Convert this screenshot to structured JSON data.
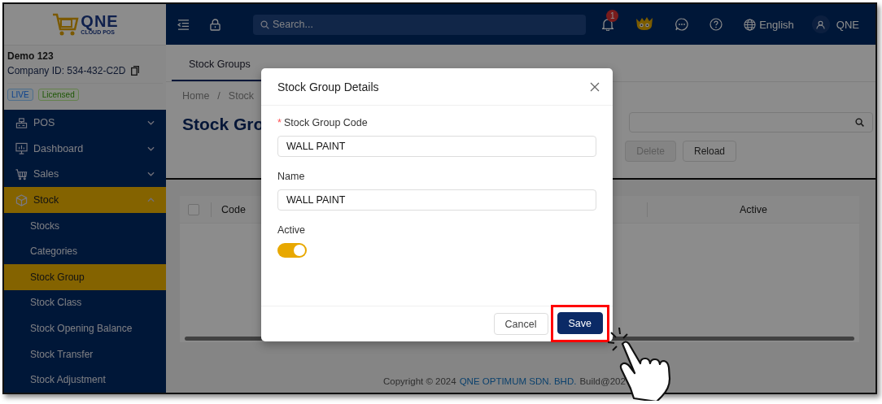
{
  "logo": {
    "text": "QNE",
    "subtext": "CLOUD POS"
  },
  "header": {
    "search": {
      "placeholder": "Search..."
    },
    "notifications": "1",
    "language": "English",
    "user": "QNE"
  },
  "company": {
    "name": "Demo 123",
    "id_text": "Company ID: 534-432-C2D",
    "badges": [
      {
        "label": "LIVE",
        "kind": "live"
      },
      {
        "label": "Licensed",
        "kind": "licensed"
      }
    ]
  },
  "sidebar": {
    "items": [
      {
        "label": "POS",
        "expanded": false,
        "selected": false
      },
      {
        "label": "Dashboard",
        "expanded": false,
        "selected": false
      },
      {
        "label": "Sales",
        "expanded": false,
        "selected": false
      },
      {
        "label": "Stock",
        "expanded": true,
        "selected": true,
        "children": [
          {
            "label": "Stocks",
            "selected": false
          },
          {
            "label": "Categories",
            "selected": false
          },
          {
            "label": "Stock Group",
            "selected": true
          },
          {
            "label": "Stock Class",
            "selected": false
          },
          {
            "label": "Stock Opening Balance",
            "selected": false
          },
          {
            "label": "Stock Transfer",
            "selected": false
          },
          {
            "label": "Stock Adjustment",
            "selected": false
          }
        ]
      }
    ]
  },
  "tabs": [
    {
      "label": "Stock Groups",
      "selected": true
    }
  ],
  "breadcrumb": [
    "Home",
    "Stock"
  ],
  "breadcrumb_separator": "/",
  "page_title": "Stock Gro",
  "toolbar": [
    {
      "label": "Delete",
      "disabled": true
    },
    {
      "label": "Reload",
      "disabled": false
    }
  ],
  "table": {
    "select_all_checked": false,
    "columns": [
      "Code",
      "Active"
    ]
  },
  "footer": {
    "copyright": "Copyright © 2024",
    "company": "QNE OPTIMUM SDN. BHD.",
    "build": "Build@202"
  },
  "modal": {
    "title": "Stock Group Details",
    "fields": [
      {
        "label": "Stock Group Code",
        "required_mark": "*",
        "value": "WALL PAINT"
      },
      {
        "label": "Name",
        "value": "WALL PAINT"
      }
    ],
    "toggle": {
      "label": "Active",
      "on": true
    },
    "buttons": [
      {
        "label": "Cancel",
        "kind": "secondary",
        "highlighted": false
      },
      {
        "label": "Save",
        "kind": "primary",
        "highlighted": true
      }
    ]
  }
}
